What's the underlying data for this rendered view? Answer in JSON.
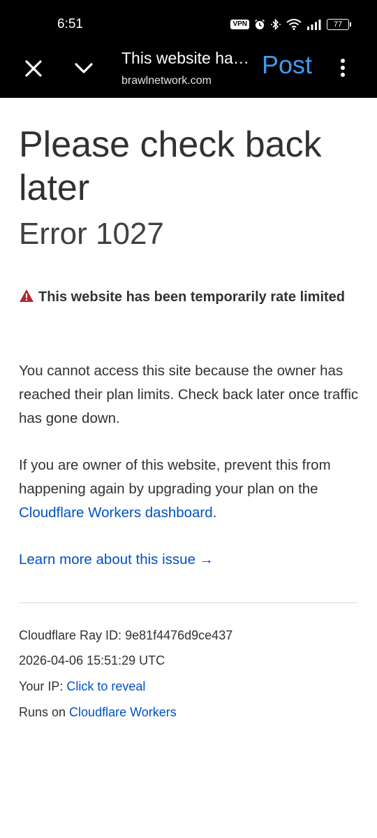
{
  "status_bar": {
    "time": "6:51",
    "vpn_label": "VPN",
    "battery_level": "77",
    "icons": [
      "vpn-icon",
      "alarm-icon",
      "bluetooth-icon",
      "wifi-icon",
      "signal-icon",
      "battery-icon"
    ]
  },
  "toolbar": {
    "title": "This website has been temporarily rate limited",
    "domain": "brawlnetwork.com",
    "post_label": "Post",
    "post_color": "#3d9cf0",
    "icons": [
      "close-icon",
      "chevron-down-icon",
      "more-vert-icon"
    ]
  },
  "page": {
    "heading": "Please check back later",
    "error_code": "Error 1027",
    "warning_text": "This website has been temporarily rate limited",
    "warning_icon": "warning-triangle-icon",
    "warning_color": "#b02a30",
    "paragraph1": "You cannot access this site because the owner has reached their plan limits. Check back later once traffic has gone down.",
    "paragraph2_prefix": "If you are owner of this website, prevent this from happening again by upgrading your plan on the ",
    "paragraph2_link": "Cloudflare Workers dashboard",
    "paragraph2_suffix": ".",
    "learn_more": "Learn more about this issue →",
    "link_color": "#0051c3"
  },
  "footer": {
    "ray_label": "Cloudflare Ray ID: ",
    "ray_id": "9e81f4476d9ce437",
    "timestamp": "2026-04-06 15:51:29 UTC",
    "ip_label": "Your IP: ",
    "ip_link": "Click to reveal",
    "runs_label": "Runs on ",
    "runs_link": "Cloudflare Workers"
  }
}
